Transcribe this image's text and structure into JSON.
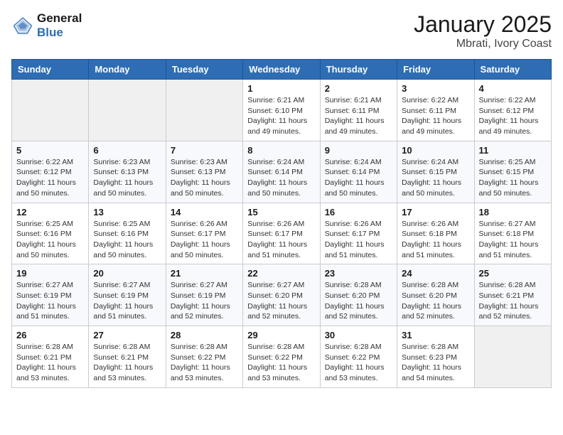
{
  "logo": {
    "line1": "General",
    "line2": "Blue"
  },
  "header": {
    "month": "January 2025",
    "location": "Mbrati, Ivory Coast"
  },
  "weekdays": [
    "Sunday",
    "Monday",
    "Tuesday",
    "Wednesday",
    "Thursday",
    "Friday",
    "Saturday"
  ],
  "weeks": [
    [
      {
        "day": "",
        "info": ""
      },
      {
        "day": "",
        "info": ""
      },
      {
        "day": "",
        "info": ""
      },
      {
        "day": "1",
        "info": "Sunrise: 6:21 AM\nSunset: 6:10 PM\nDaylight: 11 hours\nand 49 minutes."
      },
      {
        "day": "2",
        "info": "Sunrise: 6:21 AM\nSunset: 6:11 PM\nDaylight: 11 hours\nand 49 minutes."
      },
      {
        "day": "3",
        "info": "Sunrise: 6:22 AM\nSunset: 6:11 PM\nDaylight: 11 hours\nand 49 minutes."
      },
      {
        "day": "4",
        "info": "Sunrise: 6:22 AM\nSunset: 6:12 PM\nDaylight: 11 hours\nand 49 minutes."
      }
    ],
    [
      {
        "day": "5",
        "info": "Sunrise: 6:22 AM\nSunset: 6:12 PM\nDaylight: 11 hours\nand 50 minutes."
      },
      {
        "day": "6",
        "info": "Sunrise: 6:23 AM\nSunset: 6:13 PM\nDaylight: 11 hours\nand 50 minutes."
      },
      {
        "day": "7",
        "info": "Sunrise: 6:23 AM\nSunset: 6:13 PM\nDaylight: 11 hours\nand 50 minutes."
      },
      {
        "day": "8",
        "info": "Sunrise: 6:24 AM\nSunset: 6:14 PM\nDaylight: 11 hours\nand 50 minutes."
      },
      {
        "day": "9",
        "info": "Sunrise: 6:24 AM\nSunset: 6:14 PM\nDaylight: 11 hours\nand 50 minutes."
      },
      {
        "day": "10",
        "info": "Sunrise: 6:24 AM\nSunset: 6:15 PM\nDaylight: 11 hours\nand 50 minutes."
      },
      {
        "day": "11",
        "info": "Sunrise: 6:25 AM\nSunset: 6:15 PM\nDaylight: 11 hours\nand 50 minutes."
      }
    ],
    [
      {
        "day": "12",
        "info": "Sunrise: 6:25 AM\nSunset: 6:16 PM\nDaylight: 11 hours\nand 50 minutes."
      },
      {
        "day": "13",
        "info": "Sunrise: 6:25 AM\nSunset: 6:16 PM\nDaylight: 11 hours\nand 50 minutes."
      },
      {
        "day": "14",
        "info": "Sunrise: 6:26 AM\nSunset: 6:17 PM\nDaylight: 11 hours\nand 50 minutes."
      },
      {
        "day": "15",
        "info": "Sunrise: 6:26 AM\nSunset: 6:17 PM\nDaylight: 11 hours\nand 51 minutes."
      },
      {
        "day": "16",
        "info": "Sunrise: 6:26 AM\nSunset: 6:17 PM\nDaylight: 11 hours\nand 51 minutes."
      },
      {
        "day": "17",
        "info": "Sunrise: 6:26 AM\nSunset: 6:18 PM\nDaylight: 11 hours\nand 51 minutes."
      },
      {
        "day": "18",
        "info": "Sunrise: 6:27 AM\nSunset: 6:18 PM\nDaylight: 11 hours\nand 51 minutes."
      }
    ],
    [
      {
        "day": "19",
        "info": "Sunrise: 6:27 AM\nSunset: 6:19 PM\nDaylight: 11 hours\nand 51 minutes."
      },
      {
        "day": "20",
        "info": "Sunrise: 6:27 AM\nSunset: 6:19 PM\nDaylight: 11 hours\nand 51 minutes."
      },
      {
        "day": "21",
        "info": "Sunrise: 6:27 AM\nSunset: 6:19 PM\nDaylight: 11 hours\nand 52 minutes."
      },
      {
        "day": "22",
        "info": "Sunrise: 6:27 AM\nSunset: 6:20 PM\nDaylight: 11 hours\nand 52 minutes."
      },
      {
        "day": "23",
        "info": "Sunrise: 6:28 AM\nSunset: 6:20 PM\nDaylight: 11 hours\nand 52 minutes."
      },
      {
        "day": "24",
        "info": "Sunrise: 6:28 AM\nSunset: 6:20 PM\nDaylight: 11 hours\nand 52 minutes."
      },
      {
        "day": "25",
        "info": "Sunrise: 6:28 AM\nSunset: 6:21 PM\nDaylight: 11 hours\nand 52 minutes."
      }
    ],
    [
      {
        "day": "26",
        "info": "Sunrise: 6:28 AM\nSunset: 6:21 PM\nDaylight: 11 hours\nand 53 minutes."
      },
      {
        "day": "27",
        "info": "Sunrise: 6:28 AM\nSunset: 6:21 PM\nDaylight: 11 hours\nand 53 minutes."
      },
      {
        "day": "28",
        "info": "Sunrise: 6:28 AM\nSunset: 6:22 PM\nDaylight: 11 hours\nand 53 minutes."
      },
      {
        "day": "29",
        "info": "Sunrise: 6:28 AM\nSunset: 6:22 PM\nDaylight: 11 hours\nand 53 minutes."
      },
      {
        "day": "30",
        "info": "Sunrise: 6:28 AM\nSunset: 6:22 PM\nDaylight: 11 hours\nand 53 minutes."
      },
      {
        "day": "31",
        "info": "Sunrise: 6:28 AM\nSunset: 6:23 PM\nDaylight: 11 hours\nand 54 minutes."
      },
      {
        "day": "",
        "info": ""
      }
    ]
  ]
}
